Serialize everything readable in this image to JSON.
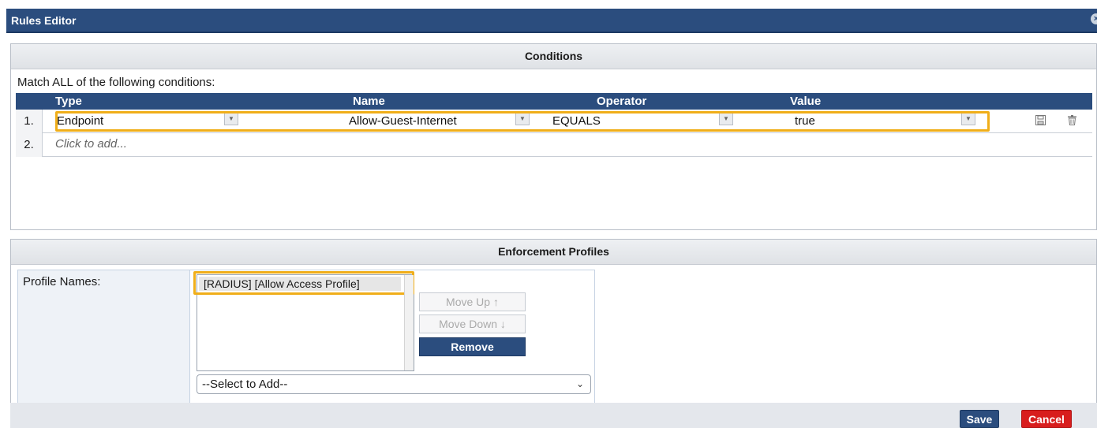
{
  "window": {
    "title": "Rules Editor"
  },
  "conditions": {
    "header": "Conditions",
    "match_text": "Match ALL of the following conditions:",
    "columns": {
      "type": "Type",
      "name": "Name",
      "operator": "Operator",
      "value": "Value"
    },
    "rows": [
      {
        "num": "1.",
        "type": "Endpoint",
        "name": "Allow-Guest-Internet",
        "operator": "EQUALS",
        "value": "true"
      }
    ],
    "add_row": {
      "num": "2.",
      "placeholder": "Click to add..."
    }
  },
  "enforcement": {
    "header": "Enforcement Profiles",
    "label": "Profile Names:",
    "profiles": [
      "[RADIUS] [Allow Access Profile]"
    ],
    "move_up": "Move Up ↑",
    "move_down": "Move Down ↓",
    "remove": "Remove",
    "select_placeholder": "--Select to Add--"
  },
  "footer": {
    "save": "Save",
    "cancel": "Cancel"
  },
  "colors": {
    "header_blue": "#2b4d7e",
    "highlight": "#f0ae19",
    "cancel_red": "#d81d1d"
  }
}
